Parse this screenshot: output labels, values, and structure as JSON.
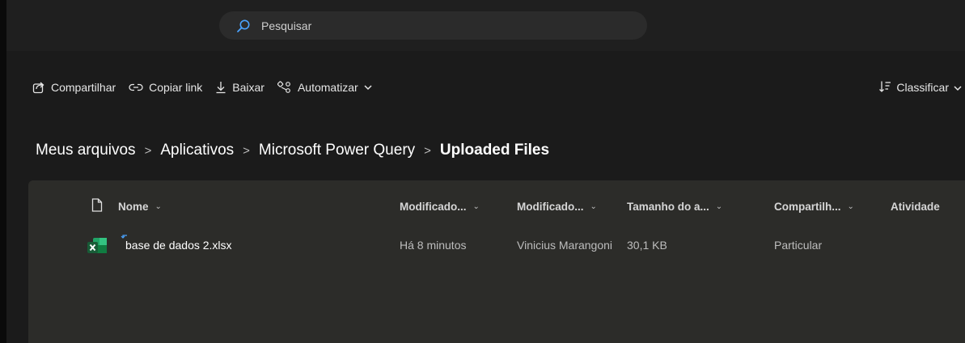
{
  "search": {
    "placeholder": "Pesquisar"
  },
  "commands": {
    "share": "Compartilhar",
    "copy_link": "Copiar link",
    "download": "Baixar",
    "automate": "Automatizar"
  },
  "sort": {
    "label": "Classificar"
  },
  "breadcrumb": {
    "items": [
      "Meus arquivos",
      "Aplicativos",
      "Microsoft Power Query"
    ],
    "current": "Uploaded Files"
  },
  "columns": {
    "name": "Nome",
    "modified": "Modificado...",
    "modified_by": "Modificado...",
    "size": "Tamanho do a...",
    "sharing": "Compartilh...",
    "activity": "Atividade"
  },
  "files": [
    {
      "name": "base de dados 2.xlsx",
      "modified": "Há 8 minutos",
      "modified_by": "Vinicius Marangoni",
      "size": "30,1 KB",
      "sharing": "Particular",
      "icon": "excel-file-icon"
    }
  ],
  "colors": {
    "background": "#1b1b1b",
    "panel": "#2c2c29",
    "search": "#2b2b2b",
    "accent": "#4aa3ff",
    "excel": "#1f7a42"
  }
}
